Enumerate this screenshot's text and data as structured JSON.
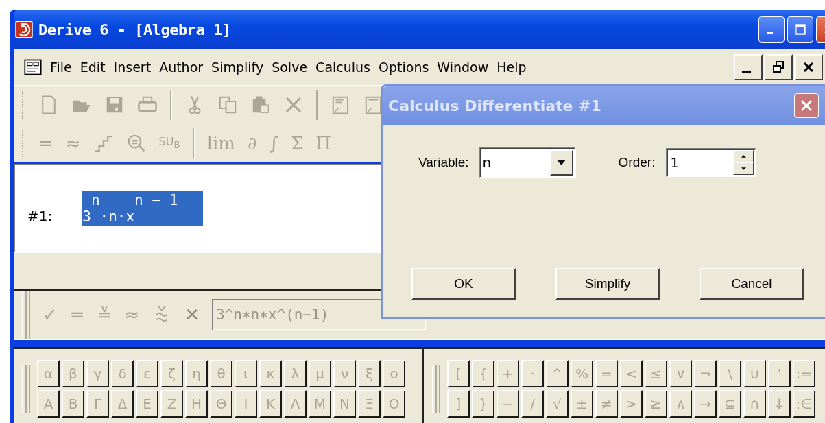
{
  "window": {
    "title": "Derive 6 - [Algebra 1]"
  },
  "menu": [
    {
      "parts": [
        {
          "text": "F",
          "underlined": true
        },
        {
          "text": "ile",
          "underlined": false
        }
      ]
    },
    {
      "parts": [
        {
          "text": "E",
          "underlined": true
        },
        {
          "text": "dit",
          "underlined": false
        }
      ]
    },
    {
      "parts": [
        {
          "text": "I",
          "underlined": true
        },
        {
          "text": "nsert",
          "underlined": false
        }
      ]
    },
    {
      "parts": [
        {
          "text": "A",
          "underlined": true
        },
        {
          "text": "uthor",
          "underlined": false
        }
      ]
    },
    {
      "parts": [
        {
          "text": "S",
          "underlined": true
        },
        {
          "text": "implify",
          "underlined": false
        }
      ]
    },
    {
      "parts": [
        {
          "text": "Sol",
          "underlined": false
        },
        {
          "text": "v",
          "underlined": true
        },
        {
          "text": "e",
          "underlined": false
        }
      ]
    },
    {
      "parts": [
        {
          "text": "C",
          "underlined": true
        },
        {
          "text": "alculus",
          "underlined": false
        }
      ]
    },
    {
      "parts": [
        {
          "text": "O",
          "underlined": true
        },
        {
          "text": "ptions",
          "underlined": false
        }
      ]
    },
    {
      "parts": [
        {
          "text": "W",
          "underlined": true
        },
        {
          "text": "indow",
          "underlined": false
        }
      ]
    },
    {
      "parts": [
        {
          "text": "H",
          "underlined": true
        },
        {
          "text": "elp",
          "underlined": false
        }
      ]
    }
  ],
  "math_buttons": [
    "=",
    "≈",
    "SU$_{B}$",
    "lim",
    "∂",
    "∫",
    "Σ",
    "Π"
  ],
  "algebra": {
    "label": "#1:",
    "superscript": " n    n − 1",
    "base": "3 ·n·x",
    "selected": true
  },
  "entry": {
    "buttons": [
      "✓",
      "=",
      "≚",
      "≈",
      "✕"
    ],
    "value": "3^n∗n∗x^(n−1)"
  },
  "greek": [
    [
      "α",
      "β",
      "γ",
      "δ",
      "ε",
      "ζ",
      "η",
      "θ",
      "ι",
      "κ",
      "λ",
      "μ",
      "ν",
      "ξ",
      "ο"
    ],
    [
      "A",
      "B",
      "Γ",
      "Δ",
      "E",
      "Z",
      "H",
      "Θ",
      "I",
      "K",
      "Λ",
      "M",
      "N",
      "Ξ",
      "O"
    ]
  ],
  "operators": [
    [
      "[",
      "{",
      "+",
      "·",
      "^",
      "%",
      "=",
      "<",
      "≤",
      "∨",
      "¬",
      "\\",
      "∪",
      "'",
      ":="
    ],
    [
      "]",
      "}",
      "−",
      "/",
      "√",
      "±",
      "≠",
      ">",
      "≥",
      "∧",
      "→",
      "⊆",
      "∩",
      "↓",
      ":∈"
    ]
  ],
  "dialog": {
    "title": "Calculus Differentiate #1",
    "variable": {
      "label": "Variable:",
      "value": "n"
    },
    "order": {
      "label": "Order:",
      "value": "1"
    },
    "buttons": [
      "OK",
      "Simplify",
      "Cancel"
    ]
  }
}
